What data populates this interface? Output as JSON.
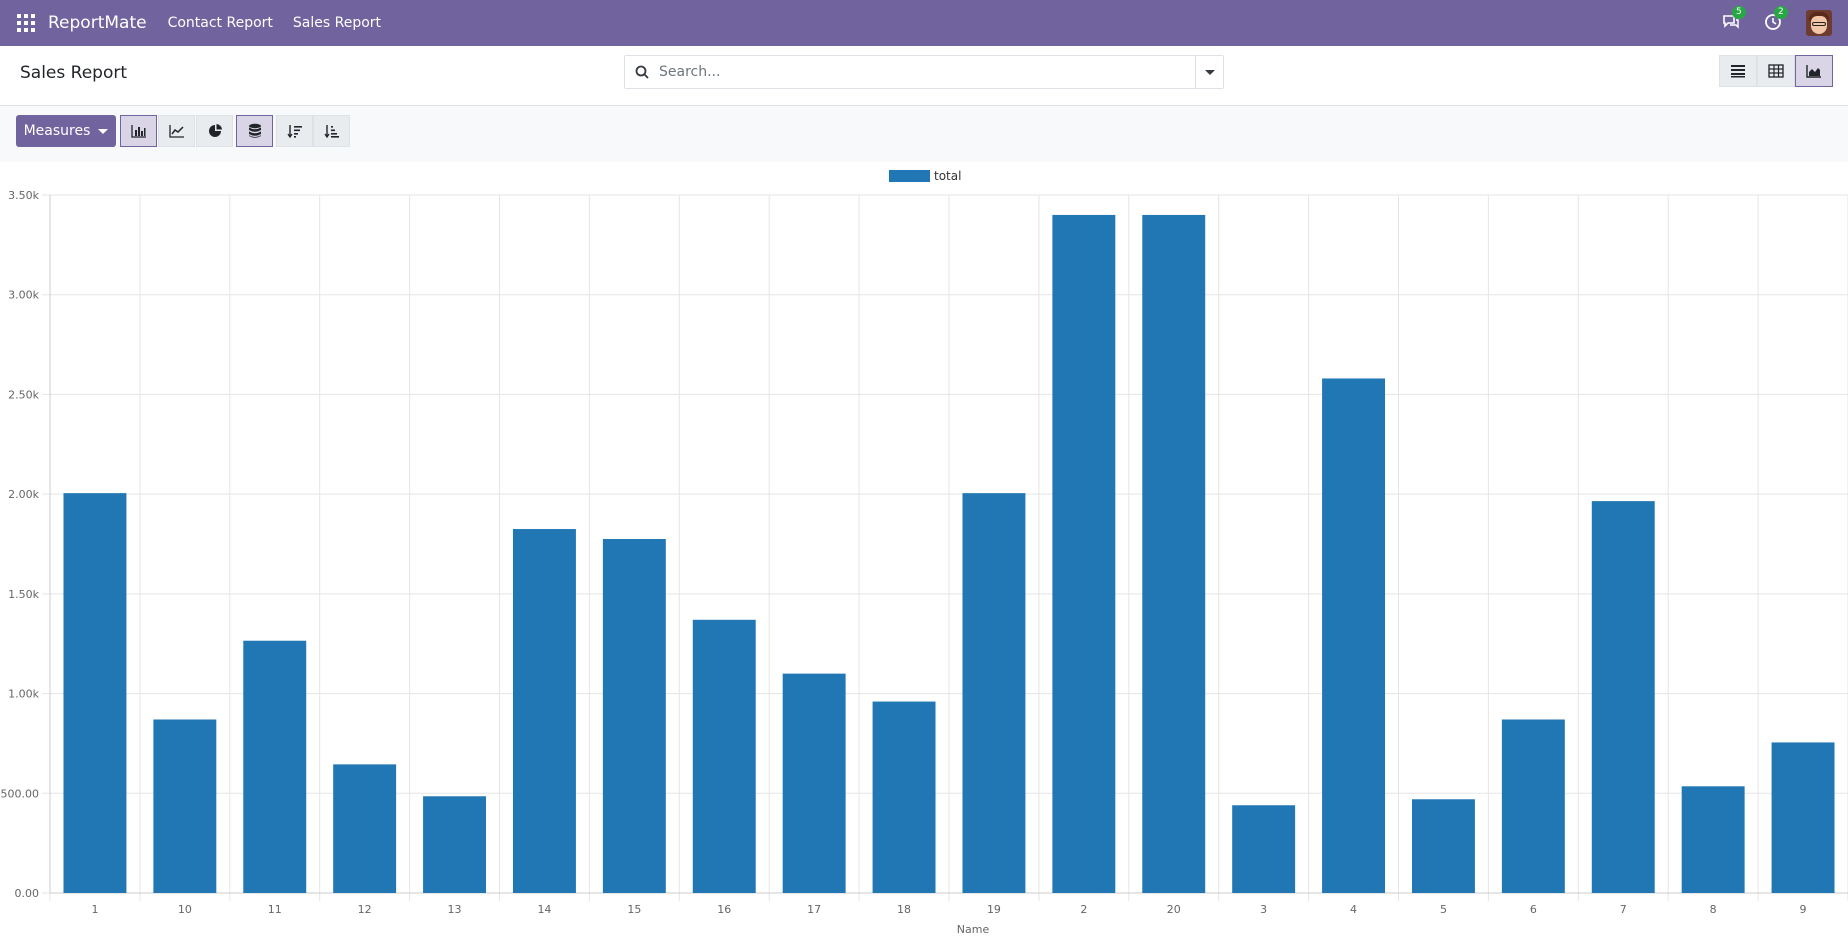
{
  "navbar": {
    "brand": "ReportMate",
    "links": [
      "Contact Report",
      "Sales Report"
    ],
    "messages_count": "5",
    "activities_count": "2"
  },
  "control_panel": {
    "title": "Sales Report",
    "search_placeholder": "Search...",
    "active_view": "graph"
  },
  "toolbar": {
    "measures_label": "Measures"
  },
  "colors": {
    "navbar": "#71639e",
    "bar": "#2077b4"
  },
  "chart_data": {
    "type": "bar",
    "legend": [
      "total"
    ],
    "xlabel": "Name",
    "ylabel": "",
    "ylim": [
      0,
      3500
    ],
    "yticks": [
      "0.00",
      "500.00",
      "1.00k",
      "1.50k",
      "2.00k",
      "2.50k",
      "3.00k",
      "3.50k"
    ],
    "categories": [
      "1",
      "10",
      "11",
      "12",
      "13",
      "14",
      "15",
      "16",
      "17",
      "18",
      "19",
      "2",
      "20",
      "3",
      "4",
      "5",
      "6",
      "7",
      "8",
      "9"
    ],
    "series": [
      {
        "name": "total",
        "values": [
          2005,
          870,
          1265,
          645,
          485,
          1825,
          1775,
          1370,
          1100,
          960,
          2005,
          3400,
          3400,
          440,
          2580,
          470,
          870,
          1965,
          535,
          755
        ]
      }
    ]
  }
}
